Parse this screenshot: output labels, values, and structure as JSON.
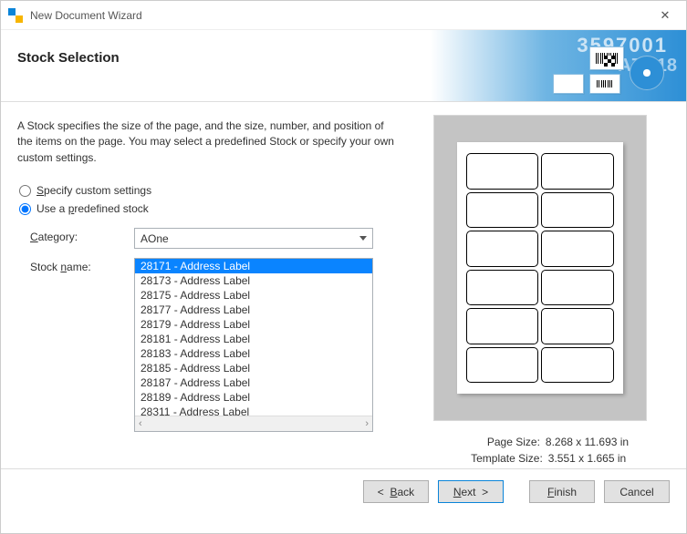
{
  "window": {
    "title": "New Document Wizard"
  },
  "header": {
    "title": "Stock Selection",
    "banner_num": "3597001",
    "banner_code": "A7-118"
  },
  "description": "A Stock specifies the size of the page, and the size, number, and position of the items on the page. You may select a predefined Stock or specify your own custom settings.",
  "radios": {
    "custom_label": "Specify custom settings",
    "predefined_label": "Use a predefined stock",
    "selected": "predefined"
  },
  "form": {
    "category_label": "Category:",
    "stockname_label": "Stock name:",
    "category_value": "AOne",
    "stock_items": [
      "28171 - Address Label",
      "28173 - Address Label",
      "28175 - Address Label",
      "28177 - Address Label",
      "28179 - Address Label",
      "28181 - Address Label",
      "28183 - Address Label",
      "28185 - Address Label",
      "28187 - Address Label",
      "28189 - Address Label",
      "28311 - Address Label"
    ],
    "selected_index": 0
  },
  "preview": {
    "columns": 2,
    "rows": 6,
    "page_size_label": "Page Size:",
    "page_size_value": "8.268 x 11.693 in",
    "template_size_label": "Template Size:",
    "template_size_value": "3.551 x 1.665 in"
  },
  "buttons": {
    "back": "<  Back",
    "next": "Next  >",
    "finish": "Finish",
    "cancel": "Cancel"
  }
}
